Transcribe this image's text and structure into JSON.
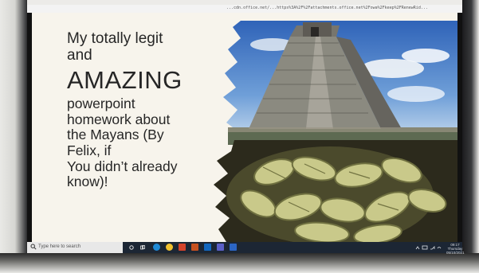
{
  "browser": {
    "url_fragment": "...cdn.office.net/...https%3A%2F%2Fattachments.office.net%2Fowa%2Fkeep%2FRenewRid..."
  },
  "slide": {
    "text_lines": [
      "My totally legit",
      "and",
      "AMAZING",
      "powerpoint",
      "homework about",
      "the Mayans (By",
      "Felix, if",
      "You didn’t already",
      "know)!"
    ],
    "text_color": "#262626",
    "background_color": "#f7f4ec"
  },
  "taskbar": {
    "search_placeholder": "Type here to search",
    "pinned_apps": [
      "task-view-icon",
      "edge-icon",
      "chrome-icon",
      "office-icon",
      "powerpoint-icon",
      "outlook-icon",
      "teams-icon",
      "word-icon"
    ],
    "tray_time": "09:17",
    "tray_day": "Thursday",
    "tray_date": "05/10/2021",
    "background_color": "#1c2634"
  }
}
